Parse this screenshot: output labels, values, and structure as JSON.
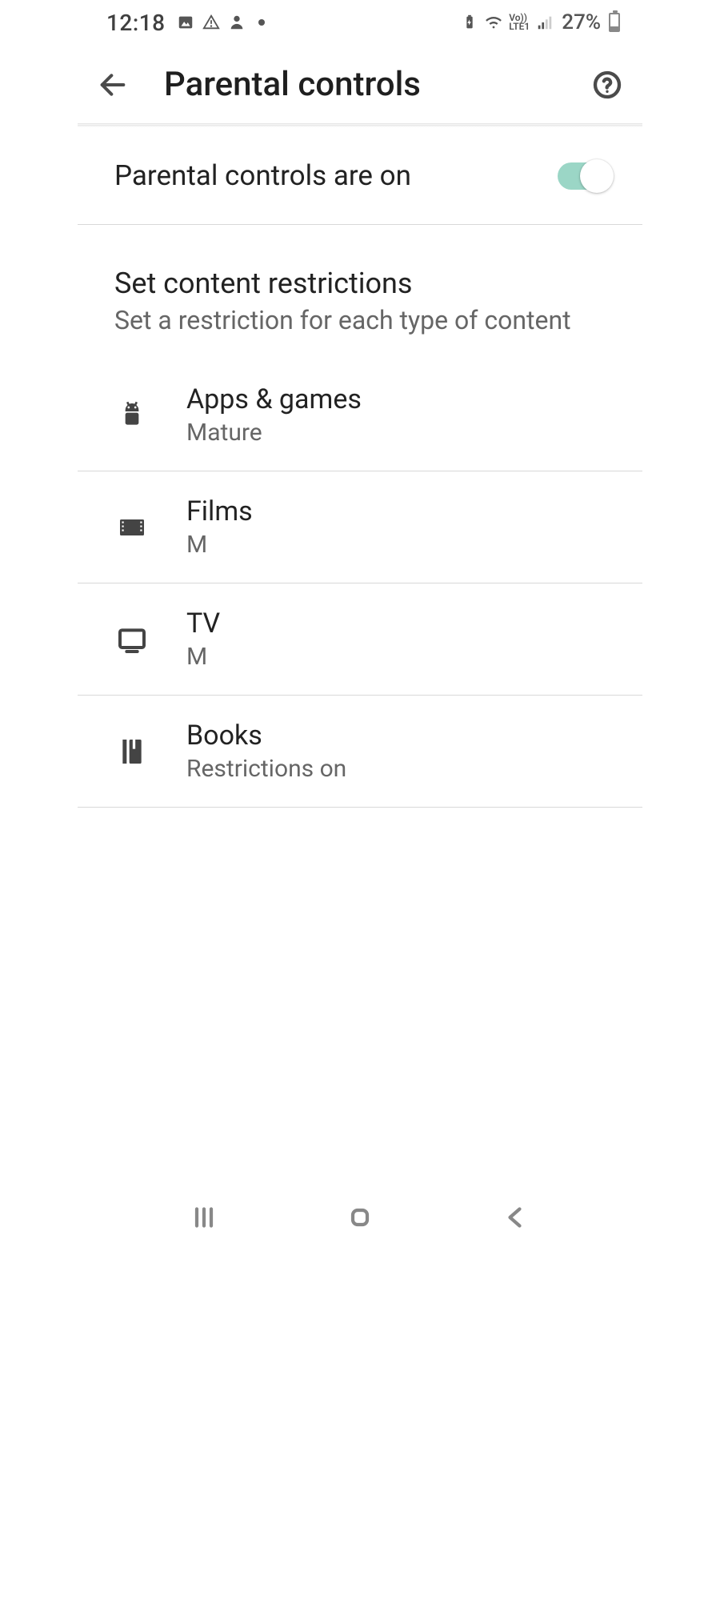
{
  "status": {
    "time": "12:18",
    "battery_pct": "27%"
  },
  "header": {
    "title": "Parental controls"
  },
  "toggle": {
    "label": "Parental controls are on",
    "on": true
  },
  "section": {
    "title": "Set content restrictions",
    "subtitle": "Set a restriction for each type of content"
  },
  "rows": {
    "apps": {
      "title": "Apps & games",
      "sub": "Mature"
    },
    "films": {
      "title": "Films",
      "sub": "M"
    },
    "tv": {
      "title": "TV",
      "sub": "M"
    },
    "books": {
      "title": "Books",
      "sub": "Restrictions on"
    }
  }
}
